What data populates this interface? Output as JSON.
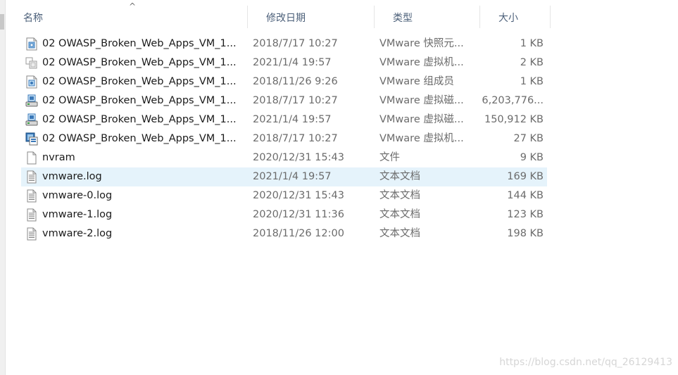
{
  "header": {
    "col_name": "名称",
    "col_date": "修改日期",
    "col_type": "类型",
    "col_size": "大小",
    "sort_indicator": "^"
  },
  "files": [
    {
      "name": "02 OWASP_Broken_Web_Apps_VM_1...",
      "date": "2018/7/17 10:27",
      "type": "VMware 快照元...",
      "size": "1 KB",
      "icon": "vmware-snapshot-icon"
    },
    {
      "name": "02 OWASP_Broken_Web_Apps_VM_1...",
      "date": "2021/1/4 19:57",
      "type": "VMware 虚拟机...",
      "size": "2 KB",
      "icon": "vmware-vm-config-icon"
    },
    {
      "name": "02 OWASP_Broken_Web_Apps_VM_1...",
      "date": "2018/11/26 9:26",
      "type": "VMware 组成员",
      "size": "1 KB",
      "icon": "vmware-team-member-icon"
    },
    {
      "name": "02 OWASP_Broken_Web_Apps_VM_1...",
      "date": "2018/7/17 10:27",
      "type": "VMware 虚拟磁...",
      "size": "6,203,776...",
      "icon": "vmware-disk-icon"
    },
    {
      "name": "02 OWASP_Broken_Web_Apps_VM_1...",
      "date": "2021/1/4 19:57",
      "type": "VMware 虚拟磁...",
      "size": "150,912 KB",
      "icon": "vmware-disk-icon"
    },
    {
      "name": "02 OWASP_Broken_Web_Apps_VM_1...",
      "date": "2018/7/17 10:27",
      "type": "VMware 虚拟机...",
      "size": "27 KB",
      "icon": "vmware-vm-icon"
    },
    {
      "name": "nvram",
      "date": "2020/12/31 15:43",
      "type": "文件",
      "size": "9 KB",
      "icon": "blank-file-icon"
    },
    {
      "name": "vmware.log",
      "date": "2021/1/4 19:57",
      "type": "文本文档",
      "size": "169 KB",
      "icon": "text-file-icon"
    },
    {
      "name": "vmware-0.log",
      "date": "2020/12/31 15:43",
      "type": "文本文档",
      "size": "144 KB",
      "icon": "text-file-icon"
    },
    {
      "name": "vmware-1.log",
      "date": "2020/12/31 11:36",
      "type": "文本文档",
      "size": "123 KB",
      "icon": "text-file-icon"
    },
    {
      "name": "vmware-2.log",
      "date": "2018/11/26 12:00",
      "type": "文本文档",
      "size": "198 KB",
      "icon": "text-file-icon"
    }
  ],
  "selected_index": 7,
  "colors": {
    "selection": "#e5f3fb",
    "header_text": "#4c607a",
    "secondary_text": "#6b6b6b"
  },
  "watermark": "https://blog.csdn.net/qq_26129413"
}
